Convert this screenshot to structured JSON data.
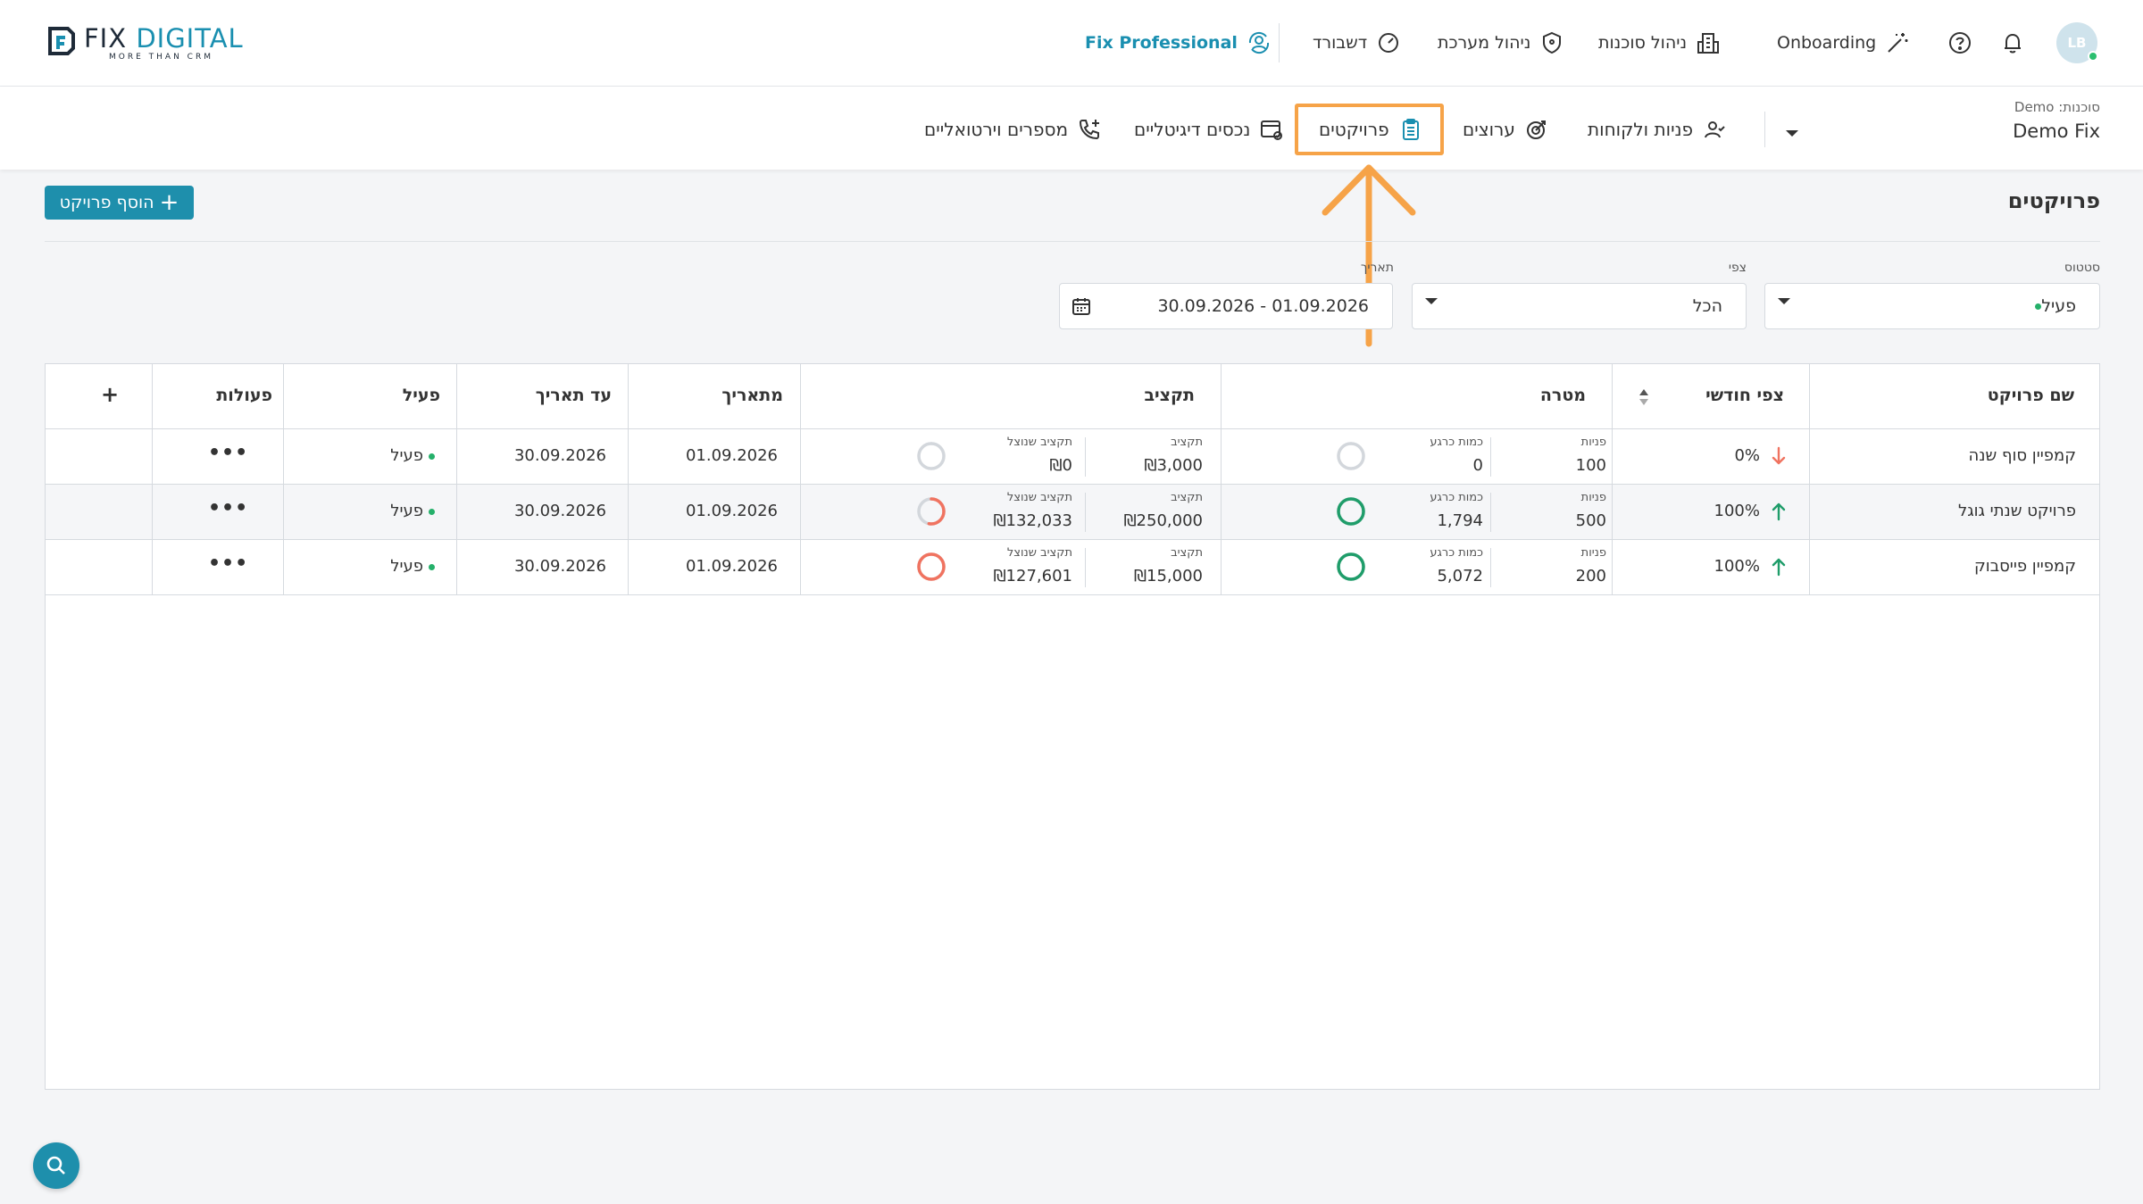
{
  "header": {
    "logo_text_a": "FIX",
    "logo_text_b": "DIGITAL",
    "logo_tagline": "MORE THAN CRM",
    "pro_label": "Fix Professional",
    "nav": [
      {
        "label": "דשבורד",
        "icon": "speedometer-icon"
      },
      {
        "label": "ניהול מערכת",
        "icon": "shield-icon"
      },
      {
        "label": "ניהול סוכנות",
        "icon": "building-icon"
      },
      {
        "label": "Onboarding",
        "icon": "magic-wand-icon"
      }
    ],
    "avatar_initials": "LB"
  },
  "subnav": {
    "agency_small": "סוכנות: Demo",
    "agency_name": "Demo Fix",
    "items": [
      {
        "label": "פניות ולקוחות",
        "icon": "users-icon"
      },
      {
        "label": "ערוצים",
        "icon": "target-icon"
      },
      {
        "label": "פרויקטים",
        "icon": "clipboard-icon"
      },
      {
        "label": "נכסים דיגיטליים",
        "icon": "browser-icon"
      },
      {
        "label": "מספרים וירטואליים",
        "icon": "phone-plus-icon"
      }
    ]
  },
  "page": {
    "title": "פרויקטים",
    "add_button": "הוסף פרויקט"
  },
  "filters": {
    "status_label": "סטטוס",
    "status_value": "פעיל",
    "forecast_label": "צפי",
    "forecast_value": "הכל",
    "date_label": "תאריך",
    "date_value": "01.09.2026 - 30.09.2026"
  },
  "table": {
    "headers": {
      "name": "שם פרויקט",
      "forecast": "צפי חודשי",
      "goal": "מטרה",
      "budget": "תקציב",
      "from": "מתאריך",
      "to": "עד תאריך",
      "active": "פעיל",
      "actions": "פעולות",
      "add": "+"
    },
    "sub_labels": {
      "leads": "פניות",
      "current": "כמות כרגע",
      "budget": "תקציב",
      "used": "תקציב שנוצל"
    },
    "rows": [
      {
        "name": "קמפיין סוף שנה",
        "forecast": "0%",
        "trend": "down",
        "leads": "100",
        "current": "0",
        "budget": "₪3,000",
        "used": "₪0",
        "from": "01.09.2026",
        "to": "30.09.2026",
        "active": "פעיל",
        "goal_fill": 0,
        "budget_fill": 0
      },
      {
        "name": "פרויקט שנתי גוגל",
        "forecast": "100%",
        "trend": "up",
        "leads": "500",
        "current": "1,794",
        "budget": "₪250,000",
        "used": "₪132,033",
        "from": "01.09.2026",
        "to": "30.09.2026",
        "active": "פעיל",
        "goal_fill": 1,
        "budget_fill": 0.53
      },
      {
        "name": "קמפיין פייסבוק",
        "forecast": "100%",
        "trend": "up",
        "leads": "200",
        "current": "5,072",
        "budget": "₪15,000",
        "used": "₪127,601",
        "from": "01.09.2026",
        "to": "30.09.2026",
        "active": "פעיל",
        "goal_fill": 1,
        "budget_fill": 1
      }
    ]
  },
  "colors": {
    "primary": "#1e8fac",
    "highlight": "#f6a348",
    "good": "#1f9d6a",
    "bad": "#f07360",
    "empty": "#d3d7dc"
  }
}
